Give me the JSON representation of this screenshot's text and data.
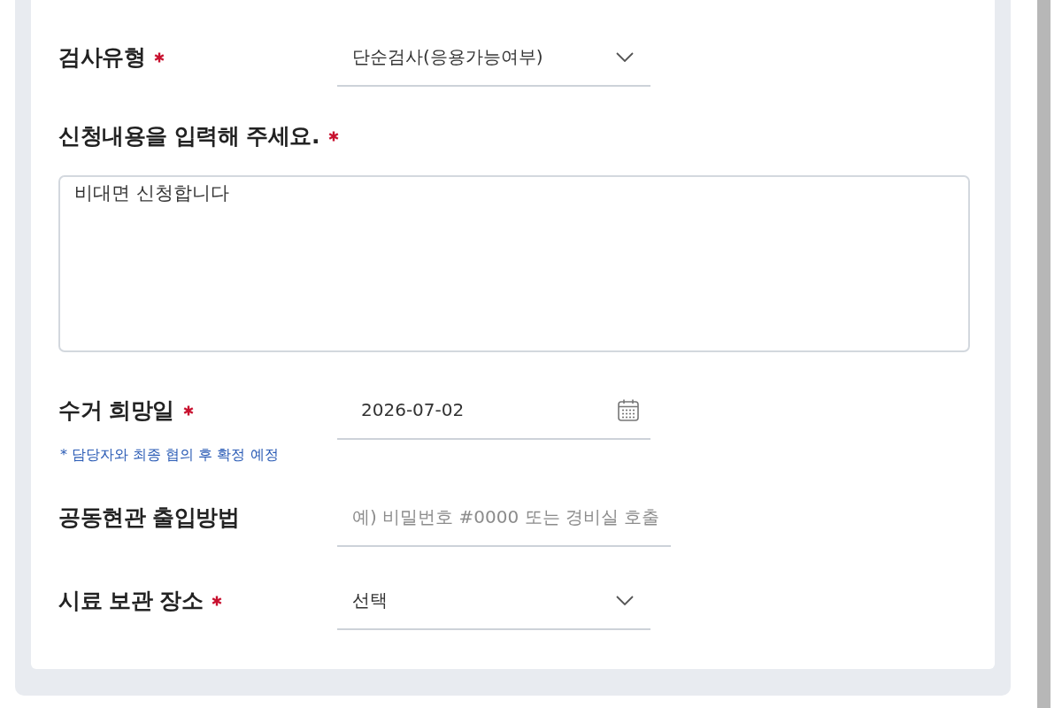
{
  "form": {
    "fields": [
      {
        "kind": "select",
        "label": "검사유형",
        "required": true,
        "value": "단순검사(응용가능여부)"
      },
      {
        "kind": "textarea",
        "label": "신청내용을 입력해 주세요.",
        "required": true,
        "value": "비대면 신청합니다"
      },
      {
        "kind": "date",
        "label": "수거 희망일",
        "required": true,
        "value": "2026-07-02",
        "note": "* 담당자와 최종 협의 후 확정 예정"
      },
      {
        "kind": "text",
        "label": "공동현관 출입방법",
        "required": false,
        "placeholder": "예) 비밀번호 #0000 또는 경비실 호출"
      },
      {
        "kind": "select",
        "label": "시료 보관 장소",
        "required": true,
        "value": "선택"
      }
    ]
  }
}
